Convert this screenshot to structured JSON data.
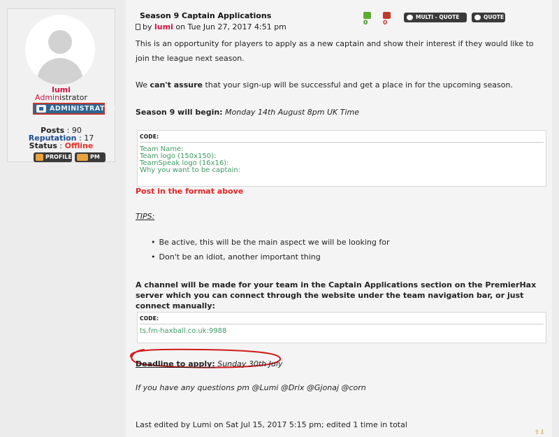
{
  "profile": {
    "username": "lumi",
    "rank_part1": "Admin",
    "rank_part2": "istrator",
    "rank_badge": "ADMINISTRATOR",
    "posts_label": "Posts",
    "posts_value": "90",
    "reputation_label": "Reputation",
    "reputation_value": "17",
    "status_label": "Status",
    "status_value": "Offline",
    "profile_button": "PROFILE",
    "pm_button": "PM"
  },
  "post": {
    "title": "Season 9 Captain Applications",
    "by": "by",
    "author": "lumi",
    "date": "on Tue Jun 27, 2017 4:51 pm",
    "like_count": "0",
    "dislike_count": "0",
    "multi_quote_label": "MULTI - QUOTE",
    "quote_label": "QUOTE",
    "paragraph1": "This is an opportunity for players to apply as a new captain and show their interest if they would like to join the league next season.",
    "p2_before": "We ",
    "p2_bold": "can't assure",
    "p2_after": " that your sign-up will be successful and get a place in for the upcoming season.",
    "p3_bold": "Season 9 will begin:",
    "p3_italic": "Monday 14th August 8pm UK Time",
    "code_label": "CODE:",
    "code1_lines": [
      "Team Name:",
      "Team logo (150x150):",
      "TeamSpeak logo (16x16):",
      "Why you want to be captain:"
    ],
    "post_format": "Post in the format above",
    "tips": "TIPS:",
    "bullets": [
      "Be active, this will be the main aspect we will be looking for",
      "Don't be an idiot, another important thing"
    ],
    "channel_text": "A channel will be made for your team in the Captain Applications section on the PremierHax server which you can connect through the website under the team navigation bar, or just connect manually:",
    "code2_line": "ts.fm-haxball.co.uk:9988",
    "deadline_bold": "Deadline to apply:",
    "deadline_italic": "Sunday 30th July",
    "questions": "If you have any questions pm @Lumi @Drix @Gjonaj @corn",
    "edited": "Last edited by Lumi on Sat Jul 15, 2017 5:15 pm; edited 1 time in total",
    "updown": "⇧⇩"
  },
  "colors": {
    "author": "#d31141",
    "offline": "#e8332b",
    "code_text": "#3d9a63",
    "post_format": "#e82222",
    "circle": "#d11a1a"
  }
}
